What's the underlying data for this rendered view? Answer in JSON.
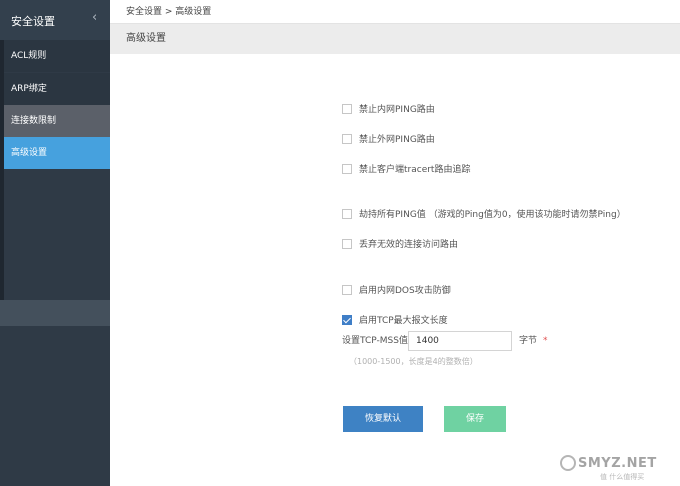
{
  "sidebar": {
    "title": "安全设置",
    "items": [
      {
        "label": "ACL规则"
      },
      {
        "label": "ARP绑定"
      },
      {
        "label": "连接数限制"
      },
      {
        "label": "高级设置"
      }
    ]
  },
  "breadcrumb": "安全设置 > 高级设置",
  "page_title": "高级设置",
  "options": [
    {
      "label": "禁止内网PING路由",
      "checked": false
    },
    {
      "label": "禁止外网PING路由",
      "checked": false
    },
    {
      "label": "禁止客户端tracert路由追踪",
      "checked": false
    },
    {
      "label": "劫持所有PING值",
      "note": "（游戏的Ping值为0，使用该功能时请勿禁Ping）",
      "checked": false
    },
    {
      "label": "丢弃无效的连接访问路由",
      "checked": false
    },
    {
      "label": "启用内网DOS攻击防御",
      "checked": false
    },
    {
      "label": "启用TCP最大报文长度",
      "checked": true
    }
  ],
  "mss": {
    "label": "设置TCP-MSS值:",
    "value": "1400",
    "unit": "字节",
    "required_mark": "*",
    "hint": "（1000-1500，长度是4的整数倍）"
  },
  "buttons": {
    "reset": "恢复默认",
    "save": "保存"
  },
  "watermark": {
    "text": "SMYZ.NET",
    "sub": "值 什么值得买"
  },
  "colors": {
    "sidebar_bg": "#2f3a46",
    "active_item": "#46a1de",
    "primary_button": "#3e82c4",
    "save_button": "#6fd2a2",
    "checkbox_checked": "#3f7ec7"
  }
}
